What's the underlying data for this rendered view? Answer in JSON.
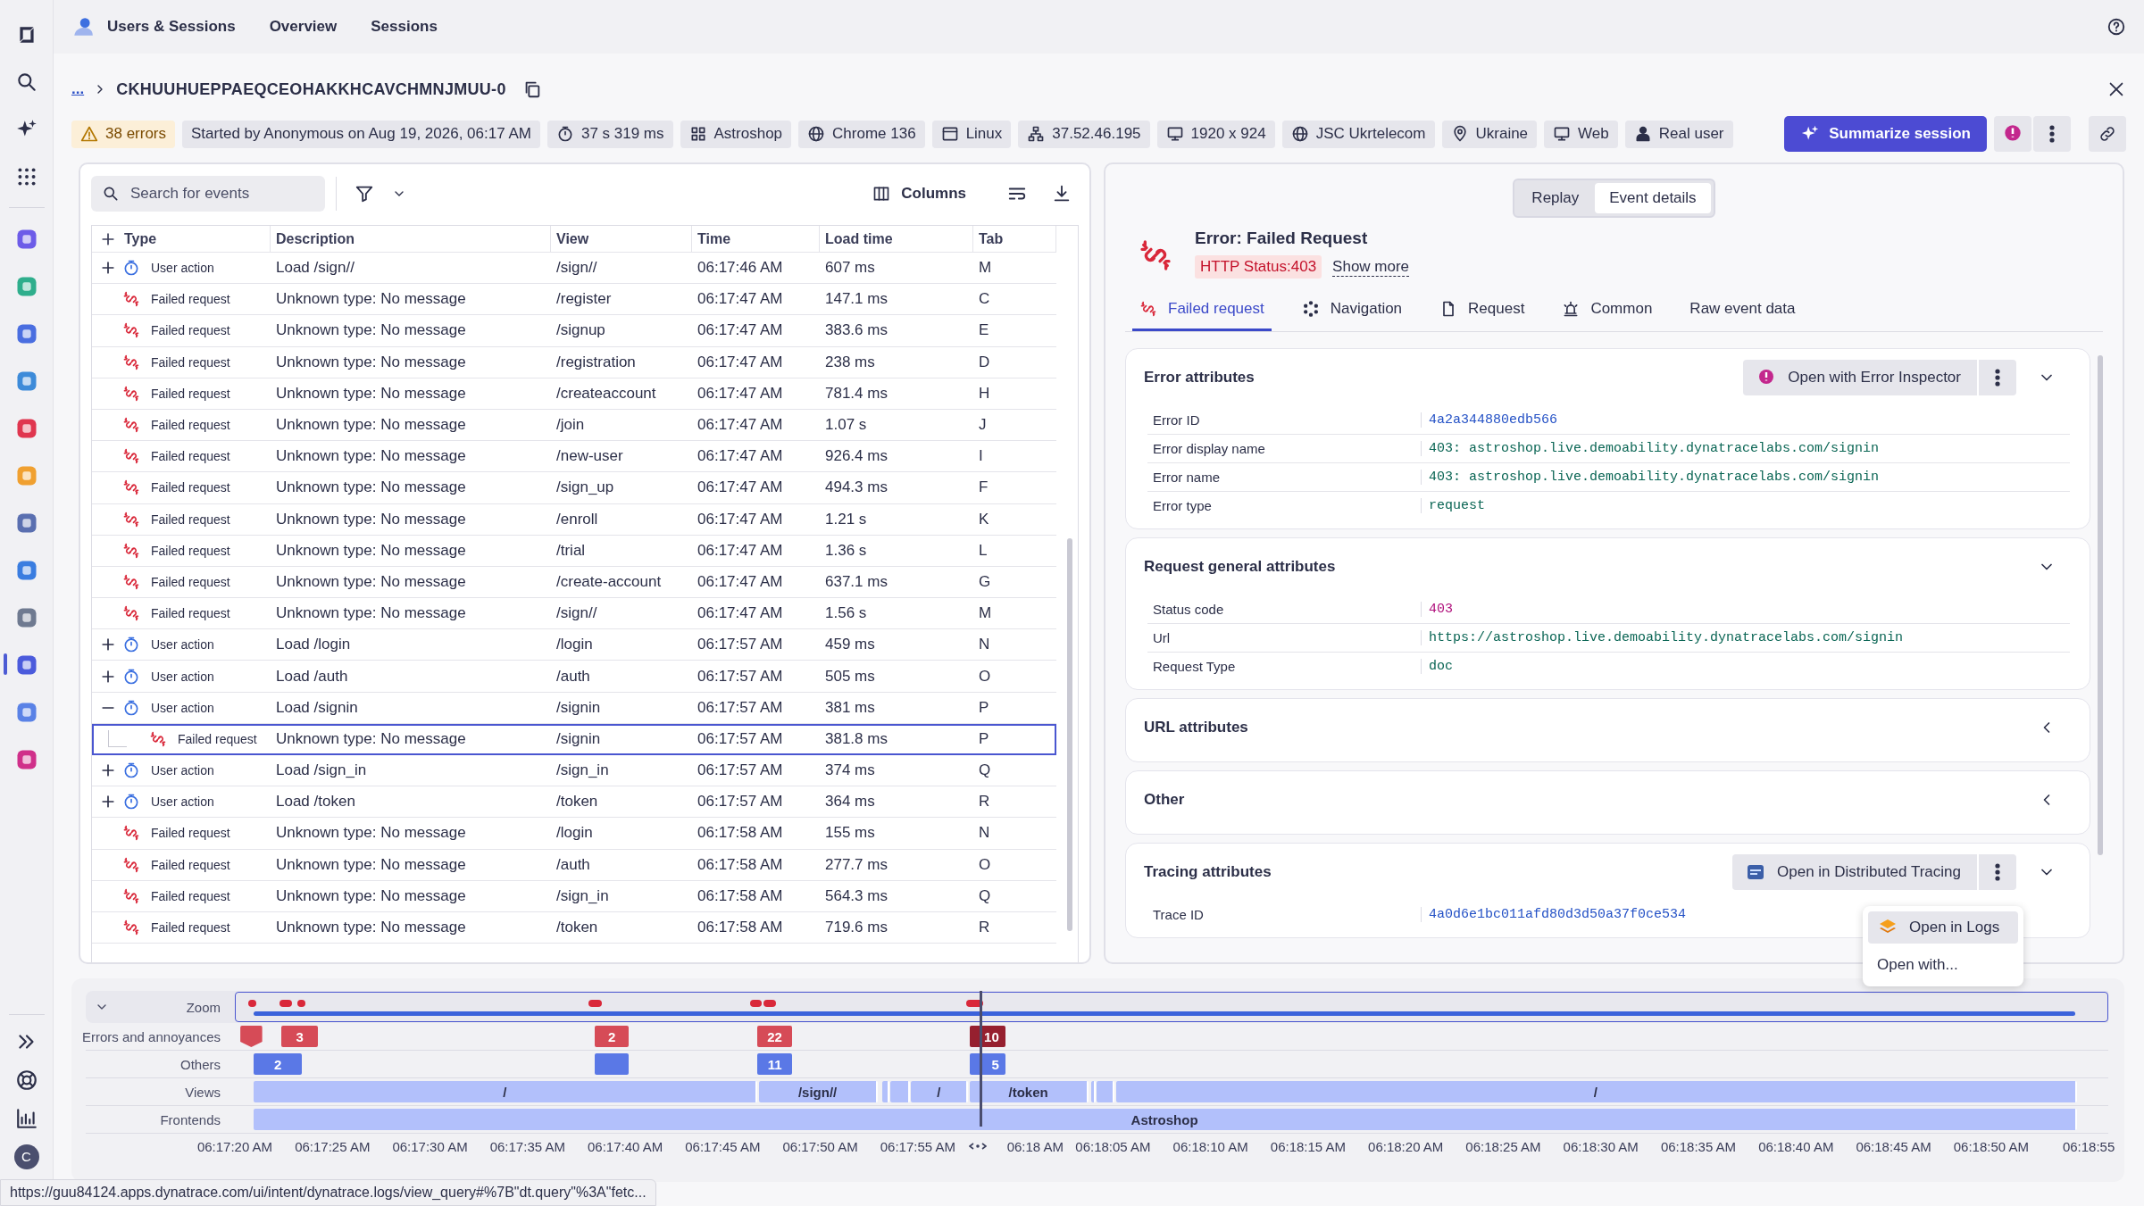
{
  "sidebar": {
    "items": [
      {
        "kind": "logo",
        "selected": false
      },
      {
        "kind": "search",
        "selected": false
      },
      {
        "kind": "sparkle",
        "selected": false
      },
      {
        "kind": "apps",
        "selected": false
      },
      {
        "kind": "app",
        "selected": false
      },
      {
        "kind": "app",
        "selected": false
      },
      {
        "kind": "app",
        "selected": false
      },
      {
        "kind": "app",
        "selected": false
      },
      {
        "kind": "app",
        "selected": false
      },
      {
        "kind": "app",
        "selected": false
      },
      {
        "kind": "app",
        "selected": false
      },
      {
        "kind": "app",
        "selected": false
      },
      {
        "kind": "app",
        "selected": false
      },
      {
        "kind": "app",
        "selected": true
      },
      {
        "kind": "app",
        "selected": false
      },
      {
        "kind": "app",
        "selected": false
      }
    ],
    "bottom": [
      {
        "kind": "expand"
      },
      {
        "kind": "support"
      },
      {
        "kind": "dashboard"
      },
      {
        "kind": "avatar",
        "text": "C"
      }
    ]
  },
  "top_bar": {
    "app": "Users & Sessions",
    "tabs": [
      "Overview",
      "Sessions"
    ]
  },
  "breadcrumb": {
    "parent": "...",
    "session_id": "CKHUUHUEPPAEQCEOHAKKHCAVCHMNJMUU-0"
  },
  "chips": [
    {
      "kind": "warning",
      "text": "38 errors"
    },
    {
      "kind": "plain",
      "text": "Started by Anonymous on Aug 19, 2026, 06:17 AM"
    },
    {
      "kind": "duration",
      "text": "37 s 319 ms"
    },
    {
      "kind": "application",
      "text": "Astroshop"
    },
    {
      "kind": "browser",
      "text": "Chrome 136"
    },
    {
      "kind": "os",
      "text": "Linux"
    },
    {
      "kind": "ip",
      "text": "37.52.46.195"
    },
    {
      "kind": "screen",
      "text": "1920 x 924"
    },
    {
      "kind": "isp",
      "text": "JSC Ukrtelecom"
    },
    {
      "kind": "location",
      "text": "Ukraine"
    },
    {
      "kind": "platform",
      "text": "Web"
    },
    {
      "kind": "user_type",
      "text": "Real user"
    }
  ],
  "summarize_button": "Summarize session",
  "events": {
    "search": {
      "placeholder": "Search for events"
    },
    "columns_button": "Columns",
    "table": {
      "columns": [
        "Type",
        "Description",
        "View",
        "Time",
        "Load time",
        "Tab"
      ],
      "rows": [
        {
          "kind": "user_action",
          "type": "User action",
          "expanded": false,
          "description": "Load /sign//",
          "view": "/sign//",
          "time": "06:17:46 AM",
          "load_time": "607 ms",
          "tab": "M",
          "selected": false
        },
        {
          "kind": "failed_request",
          "type": "Failed request",
          "description": "Unknown type: No message",
          "view": "/register",
          "time": "06:17:47 AM",
          "load_time": "147.1 ms",
          "tab": "C",
          "selected": false
        },
        {
          "kind": "failed_request",
          "type": "Failed request",
          "description": "Unknown type: No message",
          "view": "/signup",
          "time": "06:17:47 AM",
          "load_time": "383.6 ms",
          "tab": "E",
          "selected": false
        },
        {
          "kind": "failed_request",
          "type": "Failed request",
          "description": "Unknown type: No message",
          "view": "/registration",
          "time": "06:17:47 AM",
          "load_time": "238 ms",
          "tab": "D",
          "selected": false
        },
        {
          "kind": "failed_request",
          "type": "Failed request",
          "description": "Unknown type: No message",
          "view": "/createaccount",
          "time": "06:17:47 AM",
          "load_time": "781.4 ms",
          "tab": "H",
          "selected": false
        },
        {
          "kind": "failed_request",
          "type": "Failed request",
          "description": "Unknown type: No message",
          "view": "/join",
          "time": "06:17:47 AM",
          "load_time": "1.07 s",
          "tab": "J",
          "selected": false
        },
        {
          "kind": "failed_request",
          "type": "Failed request",
          "description": "Unknown type: No message",
          "view": "/new-user",
          "time": "06:17:47 AM",
          "load_time": "926.4 ms",
          "tab": "I",
          "selected": false
        },
        {
          "kind": "failed_request",
          "type": "Failed request",
          "description": "Unknown type: No message",
          "view": "/sign_up",
          "time": "06:17:47 AM",
          "load_time": "494.3 ms",
          "tab": "F",
          "selected": false
        },
        {
          "kind": "failed_request",
          "type": "Failed request",
          "description": "Unknown type: No message",
          "view": "/enroll",
          "time": "06:17:47 AM",
          "load_time": "1.21 s",
          "tab": "K",
          "selected": false
        },
        {
          "kind": "failed_request",
          "type": "Failed request",
          "description": "Unknown type: No message",
          "view": "/trial",
          "time": "06:17:47 AM",
          "load_time": "1.36 s",
          "tab": "L",
          "selected": false
        },
        {
          "kind": "failed_request",
          "type": "Failed request",
          "description": "Unknown type: No message",
          "view": "/create-account",
          "time": "06:17:47 AM",
          "load_time": "637.1 ms",
          "tab": "G",
          "selected": false
        },
        {
          "kind": "failed_request",
          "type": "Failed request",
          "description": "Unknown type: No message",
          "view": "/sign//",
          "time": "06:17:47 AM",
          "load_time": "1.56 s",
          "tab": "M",
          "selected": false
        },
        {
          "kind": "user_action",
          "type": "User action",
          "expanded": false,
          "description": "Load /login",
          "view": "/login",
          "time": "06:17:57 AM",
          "load_time": "459 ms",
          "tab": "N",
          "selected": false
        },
        {
          "kind": "user_action",
          "type": "User action",
          "expanded": false,
          "description": "Load /auth",
          "view": "/auth",
          "time": "06:17:57 AM",
          "load_time": "505 ms",
          "tab": "O",
          "selected": false
        },
        {
          "kind": "user_action",
          "type": "User action",
          "expanded": true,
          "description": "Load /signin",
          "view": "/signin",
          "time": "06:17:57 AM",
          "load_time": "381 ms",
          "tab": "P",
          "selected": false,
          "children": [
            {
              "kind": "failed_request",
              "type": "Failed request",
              "description": "Unknown type: No message",
              "view": "/signin",
              "time": "06:17:57 AM",
              "load_time": "381.8 ms",
              "tab": "P",
              "selected": true
            }
          ]
        },
        {
          "kind": "user_action",
          "type": "User action",
          "expanded": false,
          "description": "Load /sign_in",
          "view": "/sign_in",
          "time": "06:17:57 AM",
          "load_time": "374 ms",
          "tab": "Q",
          "selected": false
        },
        {
          "kind": "user_action",
          "type": "User action",
          "expanded": false,
          "description": "Load /token",
          "view": "/token",
          "time": "06:17:57 AM",
          "load_time": "364 ms",
          "tab": "R",
          "selected": false
        },
        {
          "kind": "failed_request",
          "type": "Failed request",
          "description": "Unknown type: No message",
          "view": "/login",
          "time": "06:17:58 AM",
          "load_time": "155 ms",
          "tab": "N",
          "selected": false
        },
        {
          "kind": "failed_request",
          "type": "Failed request",
          "description": "Unknown type: No message",
          "view": "/auth",
          "time": "06:17:58 AM",
          "load_time": "277.7 ms",
          "tab": "O",
          "selected": false
        },
        {
          "kind": "failed_request",
          "type": "Failed request",
          "description": "Unknown type: No message",
          "view": "/sign_in",
          "time": "06:17:58 AM",
          "load_time": "564.3 ms",
          "tab": "Q",
          "selected": false
        },
        {
          "kind": "failed_request",
          "type": "Failed request",
          "description": "Unknown type: No message",
          "view": "/token",
          "time": "06:17:58 AM",
          "load_time": "719.6 ms",
          "tab": "R",
          "selected": false
        }
      ]
    }
  },
  "details": {
    "toggle": [
      {
        "label": "Replay",
        "selected": false
      },
      {
        "label": "Event details",
        "selected": true
      }
    ],
    "title": "Error: Failed Request",
    "status_badge": "HTTP Status:403",
    "show_more": "Show more",
    "tabs": [
      {
        "kind": "failed_request",
        "label": "Failed request",
        "selected": true
      },
      {
        "kind": "navigation",
        "label": "Navigation",
        "selected": false
      },
      {
        "kind": "request",
        "label": "Request",
        "selected": false
      },
      {
        "kind": "common",
        "label": "Common",
        "selected": false
      },
      {
        "kind": "raw",
        "label": "Raw event data",
        "selected": false
      }
    ],
    "sections": [
      {
        "title": "Error attributes",
        "expanded": true,
        "action": {
          "kind": "inspector",
          "label": "Open with Error Inspector"
        },
        "rows": [
          {
            "label": "Error ID",
            "value": "4a2a344880edb566",
            "kind": "id"
          },
          {
            "label": "Error display name",
            "value": "403: astroshop.live.demoability.dynatracelabs.com/signin",
            "kind": "string"
          },
          {
            "label": "Error name",
            "value": "403: astroshop.live.demoability.dynatracelabs.com/signin",
            "kind": "string"
          },
          {
            "label": "Error type",
            "value": "request",
            "kind": "string"
          }
        ]
      },
      {
        "title": "Request general attributes",
        "expanded": true,
        "rows": [
          {
            "label": "Status code",
            "value": "403",
            "kind": "number"
          },
          {
            "label": "Url",
            "value": "https://astroshop.live.demoability.dynatracelabs.com/signin",
            "kind": "string"
          },
          {
            "label": "Request Type",
            "value": "doc",
            "kind": "string"
          }
        ]
      },
      {
        "title": "URL attributes",
        "expanded": false
      },
      {
        "title": "Other",
        "expanded": false
      },
      {
        "title": "Tracing attributes",
        "expanded": true,
        "action": {
          "kind": "tracing",
          "label": "Open in Distributed Tracing"
        },
        "rows": [
          {
            "label": "Trace ID",
            "value": "4a0d6e1bc011afd80d3d50a37f0ce534",
            "kind": "id"
          }
        ]
      }
    ]
  },
  "menu": {
    "items": [
      {
        "kind": "logs",
        "label": "Open in Logs",
        "selected": true
      },
      {
        "kind": "plain",
        "label": "Open with...",
        "selected": false
      }
    ]
  },
  "timeline": {
    "zoom_label": "Zoom",
    "lanes": [
      {
        "kind": "errors",
        "label": "Errors and annoyances",
        "markers": [
          {
            "kind": "flag",
            "selected": false
          },
          {
            "text": "3",
            "selected": false
          },
          {
            "text": "2",
            "selected": false
          },
          {
            "text": "22",
            "selected": false
          },
          {
            "text": "10",
            "selected": true
          }
        ]
      },
      {
        "kind": "others",
        "label": "Others",
        "markers": [
          {
            "text": "2"
          },
          {
            "kind": "blank"
          },
          {
            "text": "11"
          },
          {
            "text": "5"
          }
        ]
      },
      {
        "kind": "views",
        "label": "Views",
        "markers": [
          {
            "text": "/"
          },
          {
            "text": "/sign//"
          },
          {
            "text": "/"
          },
          {
            "text": "/token"
          },
          {
            "text": "/"
          }
        ]
      },
      {
        "kind": "frontends",
        "label": "Frontends",
        "markers": [
          {
            "text": "Astroshop"
          }
        ]
      }
    ],
    "ticks": [
      "06:17:20 AM",
      "06:17:25 AM",
      "06:17:30 AM",
      "06:17:35 AM",
      "06:17:40 AM",
      "06:17:45 AM",
      "06:17:50 AM",
      "06:17:55 AM",
      "06:18 AM",
      "06:18:05 AM",
      "06:18:10 AM",
      "06:18:15 AM",
      "06:18:20 AM",
      "06:18:25 AM",
      "06:18:30 AM",
      "06:18:35 AM",
      "06:18:40 AM",
      "06:18:45 AM",
      "06:18:50 AM",
      "06:18:55"
    ]
  },
  "status_url": "https://guu84124.apps.dynatrace.com/ui/intent/dynatrace.logs/view_query#%7B\"dt.query\"%3A\"fetc..."
}
